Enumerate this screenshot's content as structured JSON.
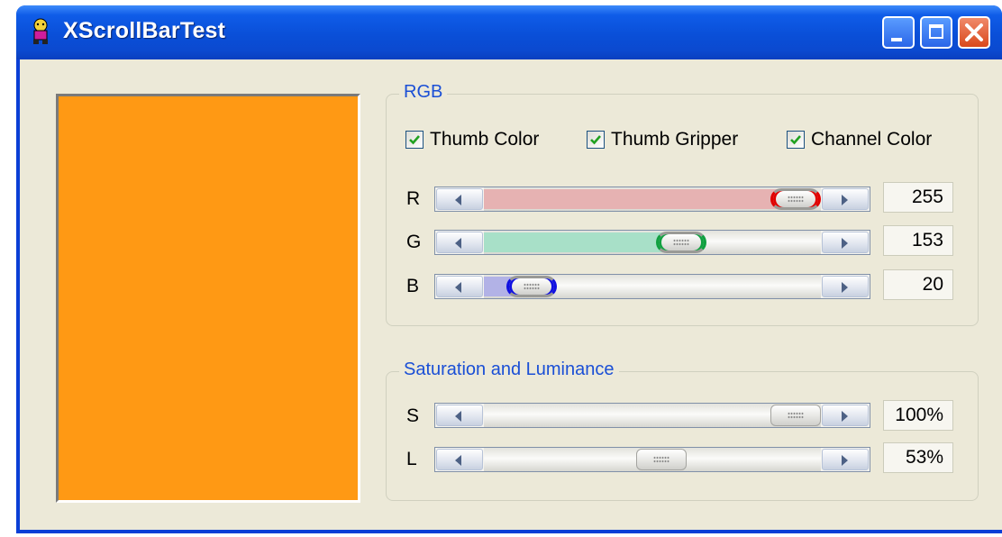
{
  "window": {
    "title": "XScrollBarTest",
    "app_icon": "xscrollbar-app-icon",
    "caption_buttons": [
      "minimize",
      "maximize",
      "close"
    ]
  },
  "preview": {
    "color": "#ff9914"
  },
  "rgb_group": {
    "title": "RGB",
    "checkboxes": [
      {
        "label": "Thumb Color",
        "checked": true
      },
      {
        "label": "Thumb Gripper",
        "checked": true
      },
      {
        "label": "Channel Color",
        "checked": true
      }
    ],
    "channels": [
      {
        "label": "R",
        "value": "255",
        "level": 1.0,
        "fill_color": "#e6b2b2",
        "thumb_color": "#e00000"
      },
      {
        "label": "G",
        "value": "153",
        "level": 0.6,
        "fill_color": "#a8e0c8",
        "thumb_color": "#10a040"
      },
      {
        "label": "B",
        "value": "20",
        "level": 0.078,
        "fill_color": "#b2b2e6",
        "thumb_color": "#1010e0"
      }
    ]
  },
  "sl_group": {
    "title": "Saturation and Luminance",
    "channels": [
      {
        "label": "S",
        "value": "100%",
        "level": 1.0
      },
      {
        "label": "L",
        "value": "53%",
        "level": 0.53
      }
    ]
  }
}
